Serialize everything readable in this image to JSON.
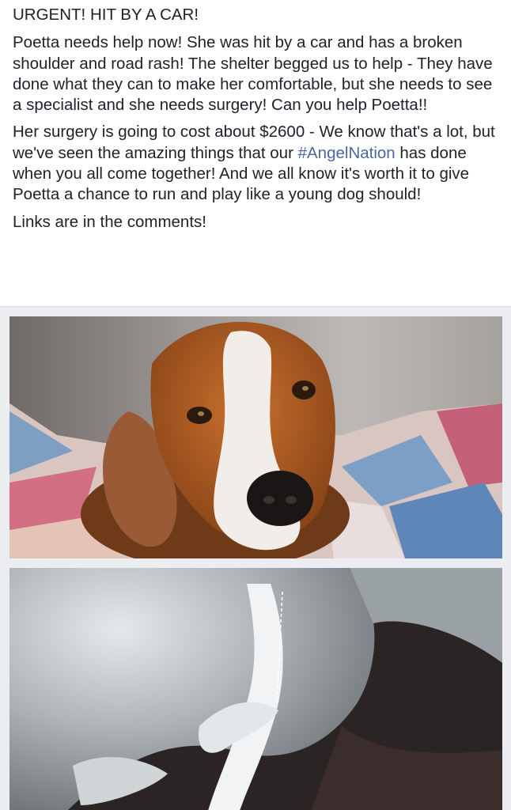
{
  "post": {
    "headline": "URGENT! HIT BY A CAR!",
    "paragraph_1": "Poetta needs help now! She was hit by a car and has a broken shoulder and road rash! The shelter begged us to help - They have done what they can to make her comfortable, but she needs to see a specialist and she needs surgery! Can you help Poetta!!",
    "paragraph_2_before": "Her surgery is going to cost about $2600 - We know that's a lot, but we've seen the amazing things that our ",
    "hashtag": "#AngelNation",
    "paragraph_2_after": " has done when you all come together! And we all know it's worth it to give Poetta a chance to run and play like a young dog should!",
    "paragraph_3": "Links are in the comments!"
  },
  "colors": {
    "text": "#1d2129",
    "hashtag": "#4b67a1",
    "media_background": "#ebedf0"
  }
}
